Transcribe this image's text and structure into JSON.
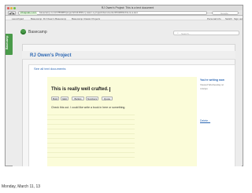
{
  "browser": {
    "window_title": "RJ Owen's Project: This is a text document",
    "nav_buttons": [
      "◀",
      "▶"
    ],
    "url_secure_label": "37signals, LLC",
    "url": "basecamp.com/1789965/projects/1111819-rj-owen-s-project/documents/1541809-this-is-a-text",
    "search_placeholder": "Google"
  },
  "breadcrumb": {
    "items": [
      "Launchpad",
      "Basecamp: RJ Owen's Basecamp",
      "Basecamp Classic Projects"
    ],
    "right_links": [
      "Personal info",
      "Switch",
      "Sign out"
    ]
  },
  "app": {
    "side_tab_label": "Basecamp",
    "logo_label": "Basecamp",
    "search_placeholder": "Search..."
  },
  "project": {
    "title": "RJ Owen's Project",
    "see_all_link": "See all text documents"
  },
  "document": {
    "heading": "This is really well crafted.",
    "toolbar": [
      "Bold",
      "Italic",
      "Bullets",
      "Numbers",
      "Quote"
    ],
    "body": "Check this out. I could like write a book in here or something."
  },
  "side_panel": {
    "status_title": "You're writing now",
    "status_sub": "Viewed Wednesday at 4:42pm",
    "delete_label": "Delete..."
  },
  "footer": {
    "date": "Monday, March 11, 13"
  },
  "colors": {
    "brand_green": "#4a9b4a",
    "doc_yellow": "#fbfcd9",
    "link_blue": "#2a66b3"
  }
}
